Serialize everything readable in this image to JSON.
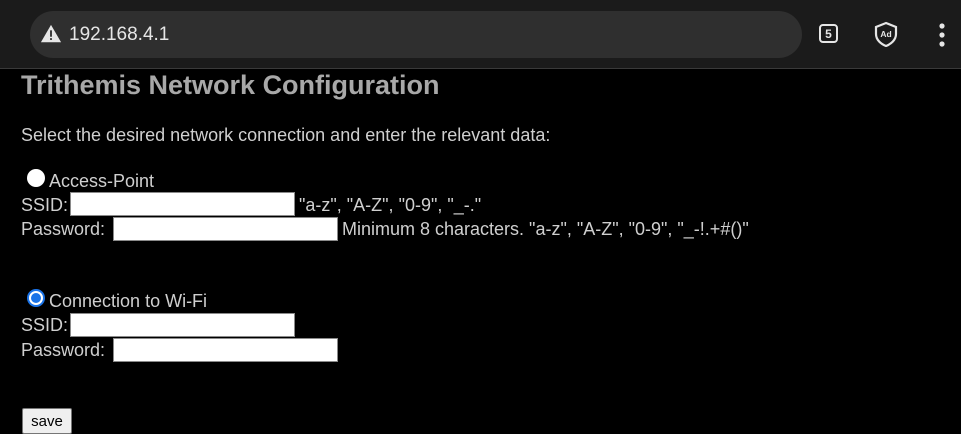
{
  "browser": {
    "url": "192.168.4.1",
    "tab_count": "5",
    "icons": [
      "warning-icon",
      "adblock-icon",
      "overflow-menu-icon"
    ]
  },
  "page": {
    "title": "Trithemis Network Configuration",
    "instruction": "Select the desired network connection and enter the relevant data:",
    "access_point": {
      "label": "Access-Point",
      "selected": false,
      "ssid_label": "SSID:",
      "ssid_value": "",
      "ssid_hint": "\"a-z\", \"A-Z\", \"0-9\", \"_-.\"",
      "password_label": "Password:",
      "password_value": "",
      "password_hint": "Minimum 8 characters. \"a-z\", \"A-Z\", \"0-9\", \"_-!.+#()\""
    },
    "wifi": {
      "label": "Connection to Wi-Fi",
      "selected": true,
      "ssid_label": "SSID:",
      "ssid_value": "",
      "password_label": "Password:",
      "password_value": ""
    },
    "save_label": "save"
  },
  "colors": {
    "background": "#000000",
    "radio_accent": "#1a73e8"
  }
}
